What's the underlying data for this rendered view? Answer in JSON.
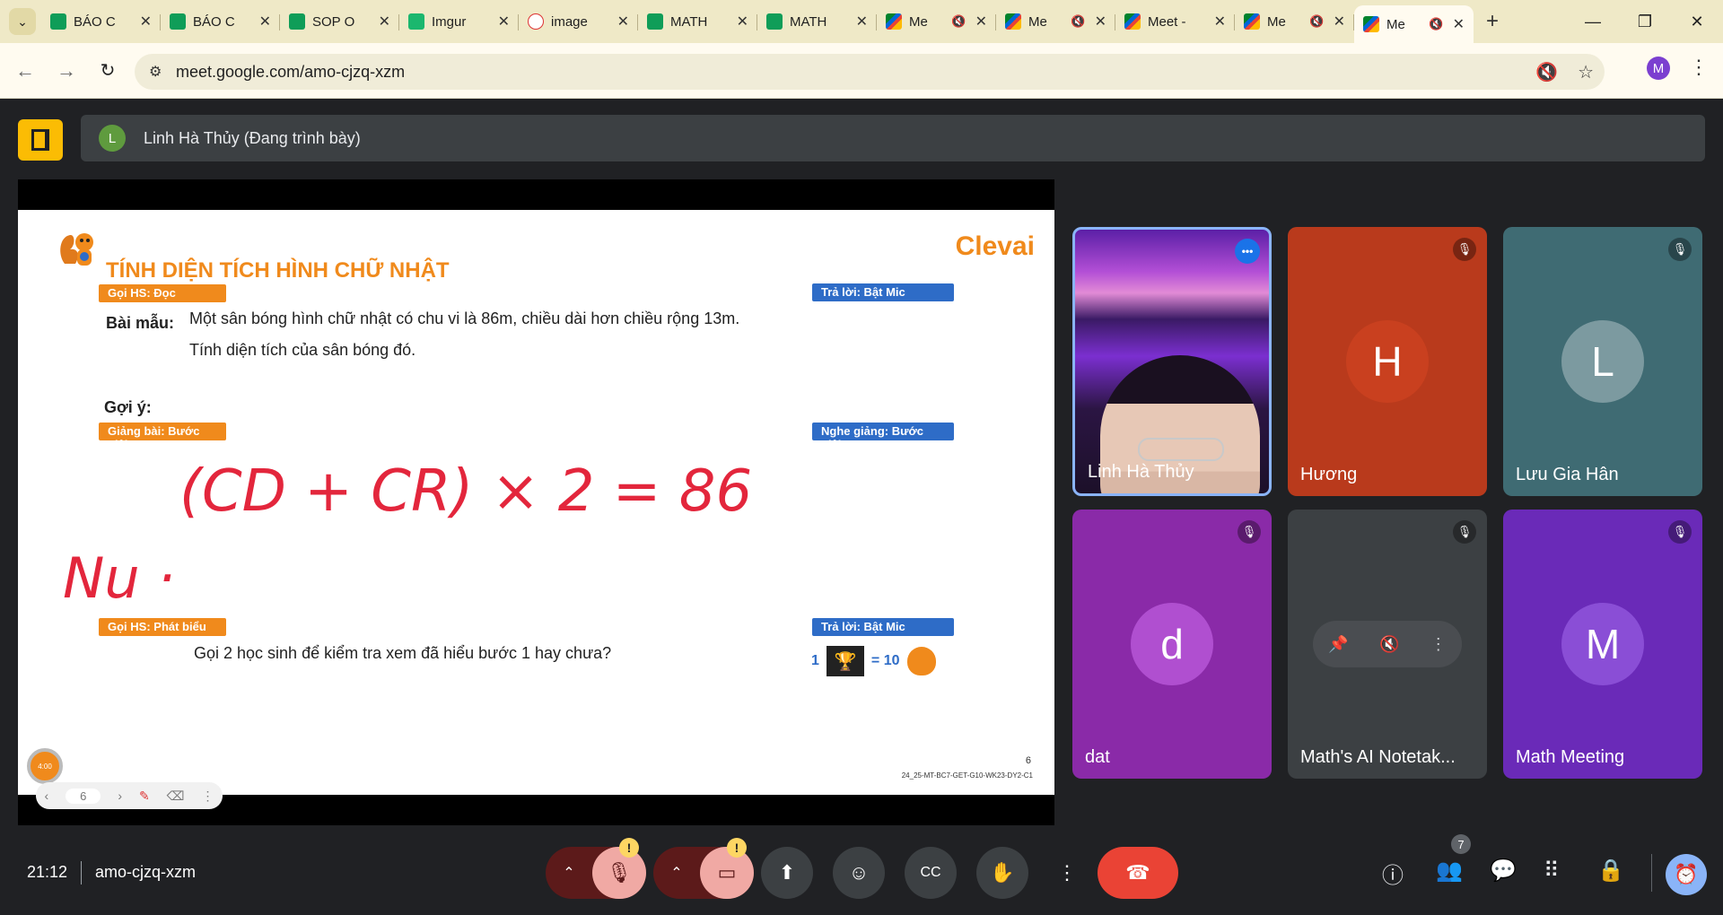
{
  "browser": {
    "tabs": [
      {
        "label": "BÁO C",
        "icon": "sheets-icon",
        "muted": false,
        "active": false
      },
      {
        "label": "BÁO C",
        "icon": "sheets-icon",
        "muted": false,
        "active": false
      },
      {
        "label": "SOP O",
        "icon": "sheets-icon",
        "muted": false,
        "active": false
      },
      {
        "label": "Imgur",
        "icon": "imgur-icon",
        "muted": false,
        "active": false
      },
      {
        "label": "image",
        "icon": "image-icon",
        "muted": false,
        "active": false
      },
      {
        "label": "MATH",
        "icon": "sheets-icon",
        "muted": false,
        "active": false
      },
      {
        "label": "MATH",
        "icon": "sheets-icon",
        "muted": false,
        "active": false
      },
      {
        "label": "Me",
        "icon": "meet-icon",
        "muted": true,
        "active": false
      },
      {
        "label": "Me",
        "icon": "meet-icon",
        "muted": true,
        "active": false
      },
      {
        "label": "Meet -",
        "icon": "meet-icon",
        "muted": false,
        "active": false
      },
      {
        "label": "Me",
        "icon": "meet-icon",
        "muted": true,
        "active": false
      },
      {
        "label": "Me",
        "icon": "meet-icon",
        "muted": true,
        "active": false
      }
    ],
    "url": "meet.google.com/amo-cjzq-xzm",
    "profile_initial": "M"
  },
  "meet": {
    "presenter_initial": "L",
    "presenter_label": "Linh Hà Thủy (Đang trình bày)",
    "time": "21:12",
    "meeting_code": "amo-cjzq-xzm",
    "people_count": "7"
  },
  "slide": {
    "title": "TÍNH DIỆN TÍCH HÌNH CHỮ NHẬT",
    "brand": "Clevai",
    "tag_read": "Gọi HS: Đọc",
    "tag_answer_mic": "Trả lời: Bật Mic",
    "sample_label": "Bài mẫu:",
    "sample_line1": "Một sân bóng hình chữ nhật có chu vi là 86m, chiều dài hơn chiều rộng 13m.",
    "sample_line2": "Tính diện tích của sân bóng đó.",
    "hint_label": "Gợi ý:",
    "tag_teach": "Giảng bài: Bước giải",
    "tag_listen": "Nghe giảng: Bước giải",
    "tag_speak": "Gọi HS: Phát biểu",
    "tag_answer_mic2": "Trả lời: Bật Mic",
    "call_text": "Gọi 2 học sinh để kiểm tra xem đã hiểu bước 1 hay chưa?",
    "score_count": "1",
    "score_value": "= 10",
    "page_number": "6",
    "slide_code": "24_25-MT-BC7-GET-G10-WK23-DY2-C1",
    "timer": "4:00",
    "nav_page": "6",
    "handwriting": "(CD + CR) × 2 = 86",
    "handwriting2": "Nu ·"
  },
  "participants": [
    {
      "name": "Linh Hà Thủy",
      "initial": "",
      "bg": "",
      "speaking": true,
      "camera": true
    },
    {
      "name": "Hương",
      "initial": "H",
      "bg": "#b93a1c",
      "avatar_bg": "#c9401f",
      "speaking": false
    },
    {
      "name": "Lưu Gia Hân",
      "initial": "L",
      "bg": "#3f6b73",
      "avatar_bg": "#7c9aa0",
      "speaking": false
    },
    {
      "name": "dat",
      "initial": "d",
      "bg": "#8a2aa8",
      "avatar_bg": "#b04fd0",
      "speaking": false
    },
    {
      "name": "Math's AI Notetak...",
      "initial": "",
      "bg": "#3c4043",
      "speaking": false
    },
    {
      "name": "Math Meeting",
      "initial": "M",
      "bg": "#6a2ab8",
      "avatar_bg": "#8a4ed6",
      "speaking": false
    }
  ],
  "colors": {
    "accent_orange": "#f08a1c",
    "tag_blue": "#2e6cc7",
    "leave_red": "#ea4335",
    "meet_bg": "#202124"
  }
}
